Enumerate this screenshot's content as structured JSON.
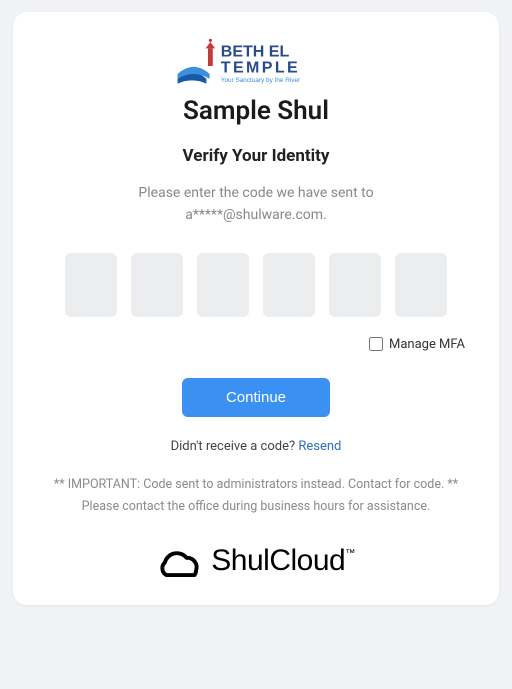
{
  "logo": {
    "line1": "BETH EL",
    "line2": "TEMPLE",
    "tagline": "Your Sanctuary by the River"
  },
  "org_name": "Sample Shul",
  "verify_title": "Verify Your Identity",
  "instruction_line1": "Please enter the code we have sent to",
  "instruction_line2": "a*****@shulware.com.",
  "manage_mfa_label": "Manage MFA",
  "continue_label": "Continue",
  "resend_prompt": "Didn't receive a code?",
  "resend_link": "Resend",
  "notice": "** IMPORTANT: Code sent to administrators instead. Contact for code. ** Please contact the office during business hours for assistance.",
  "footer_brand": "ShulCloud",
  "footer_tm": "™"
}
